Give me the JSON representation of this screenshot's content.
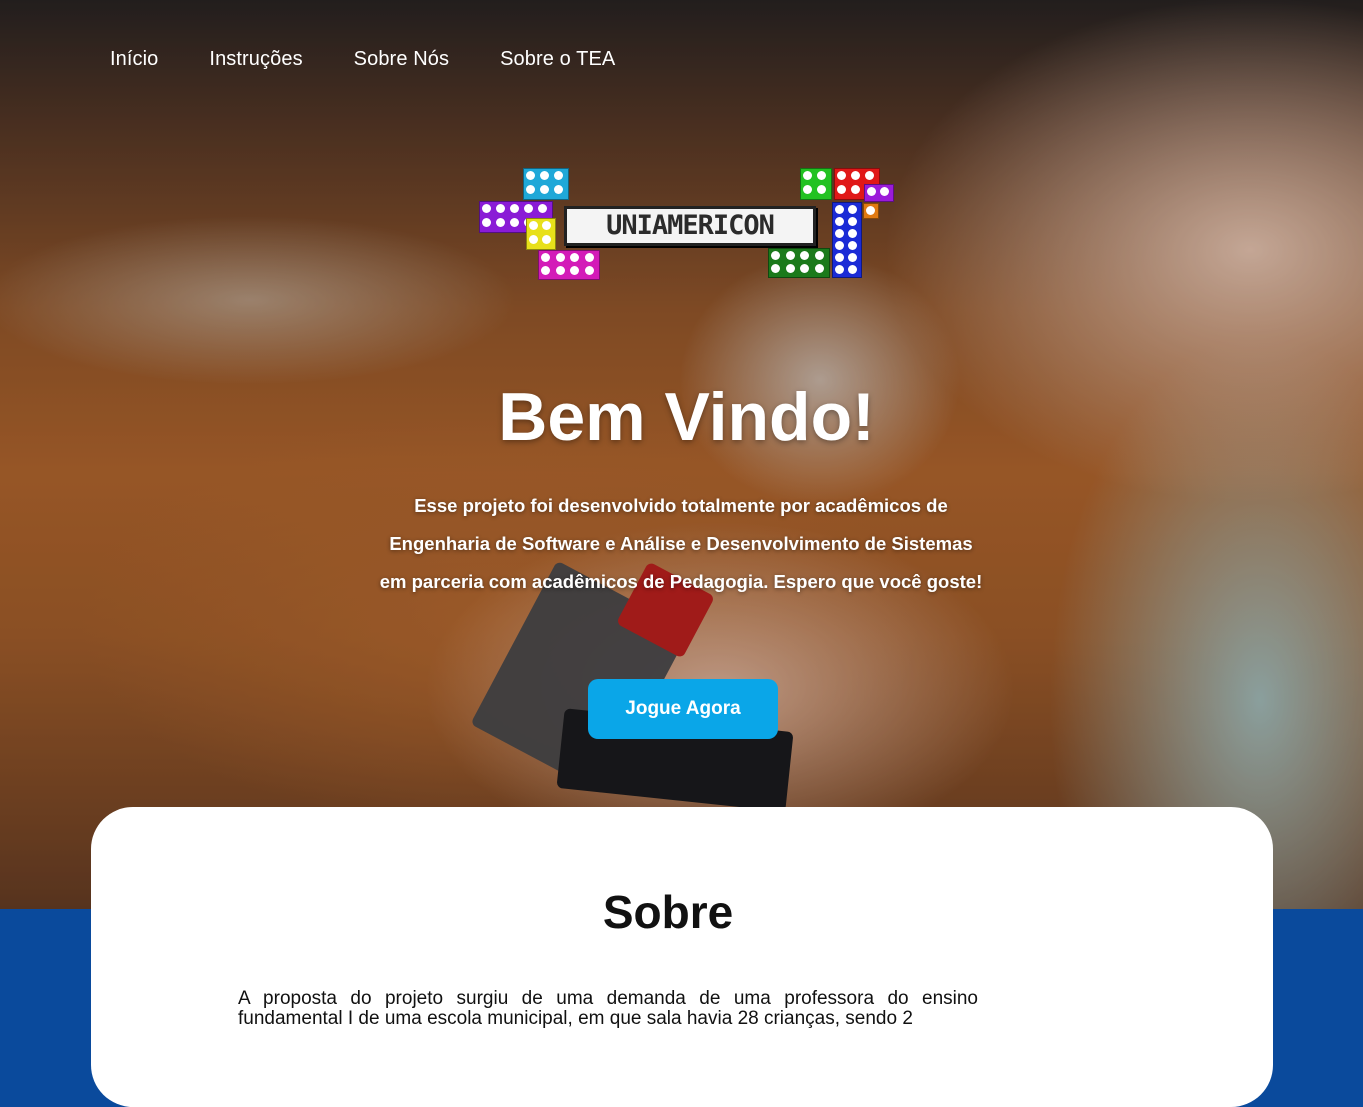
{
  "nav": {
    "items": [
      {
        "label": "Início"
      },
      {
        "label": "Instruções"
      },
      {
        "label": "Sobre Nós"
      },
      {
        "label": "Sobre o TEA"
      }
    ]
  },
  "logo": {
    "text": "UNIAMERICON",
    "colors": [
      "#1fa8d8",
      "#8a1bd6",
      "#e8e01a",
      "#d31bb8",
      "#22c222",
      "#e01818",
      "#9b1bd9",
      "#1b2bd6",
      "#e07a12",
      "#1b7a1b"
    ]
  },
  "hero": {
    "title": "Bem Vindo!",
    "description_lines": [
      "Esse projeto foi desenvolvido totalmente por acadêmicos de",
      "Engenharia de Software e Análise e Desenvolvimento de Sistemas",
      "em parceria com acadêmicos de Pedagogia. Espero que você goste!"
    ],
    "cta_label": "Jogue Agora",
    "cta_color": "#0aa6e8"
  },
  "about": {
    "title": "Sobre",
    "text": "A proposta do projeto surgiu de uma demanda de uma professora do ensino fundamental I de uma escola municipal, em que sala havia 28 crianças, sendo 2"
  },
  "theme": {
    "footer_band_color": "#0a4a9c"
  }
}
